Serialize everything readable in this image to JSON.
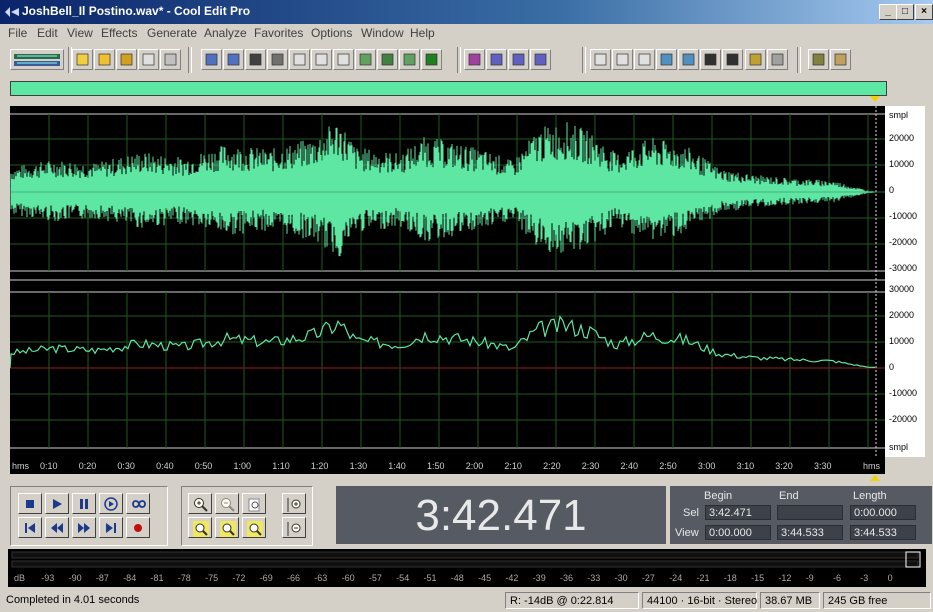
{
  "window": {
    "title": "JoshBell_Il Postino.wav* - Cool Edit Pro",
    "minimize_glyph": "_",
    "maximize_glyph": "□",
    "close_glyph": "×"
  },
  "menu": [
    "File",
    "Edit",
    "View",
    "Effects",
    "Generate",
    "Analyze",
    "Favorites",
    "Options",
    "Window",
    "Help"
  ],
  "toolbar": {
    "icons": [
      "multitrack-toggle-icon",
      "new-file-icon",
      "open-file-icon",
      "save-icon",
      "save-all-icon",
      "close-file-icon",
      "undo-icon",
      "redo-icon",
      "repeat-last-icon",
      "cut-icon",
      "copy-icon",
      "paste-icon",
      "mix-paste-icon",
      "trim-icon",
      "envelope-icon",
      "favorites-icon",
      "spectral-view-icon",
      "waveform-view-icon",
      "spectral-freq-icon",
      "spectral-pan-icon",
      "cue-list-icon",
      "play-list-icon",
      "info-icon",
      "zoom-out-full-icon",
      "zoom-to-sel-icon",
      "time-format-icon",
      "snap-icon",
      "levels-icon",
      "status-icon",
      "settings-icon",
      "script-icon",
      "help-icon"
    ]
  },
  "waveform": {
    "top_channel_labels": [
      "smpl",
      "20000",
      "10000",
      "0",
      "-10000",
      "-20000",
      "-30000"
    ],
    "bottom_channel_labels": [
      "30000",
      "20000",
      "10000",
      "0",
      "-10000",
      "-20000",
      "smpl"
    ],
    "color": "#5ee6a3",
    "grid_color": "#1f5a1f"
  },
  "timeline": {
    "start_label": "hms",
    "end_label": "hms",
    "ticks": [
      "0:10",
      "0:20",
      "0:30",
      "0:40",
      "0:50",
      "1:00",
      "1:10",
      "1:20",
      "1:30",
      "1:40",
      "1:50",
      "2:00",
      "2:10",
      "2:20",
      "2:30",
      "2:40",
      "2:50",
      "3:00",
      "3:10",
      "3:20",
      "3:30"
    ]
  },
  "time_display": "3:42.471",
  "selection": {
    "headers": {
      "begin": "Begin",
      "end": "End",
      "length": "Length"
    },
    "sel": {
      "label": "Sel",
      "begin": "3:42.471",
      "end": "",
      "length": "0:00.000"
    },
    "view": {
      "label": "View",
      "begin": "0:00.000",
      "end": "3:44.533",
      "length": "3:44.533"
    }
  },
  "meter": {
    "db_labels": [
      "dB",
      "-93",
      "-90",
      "-87",
      "-84",
      "-81",
      "-78",
      "-75",
      "-72",
      "-69",
      "-66",
      "-63",
      "-60",
      "-57",
      "-54",
      "-51",
      "-48",
      "-45",
      "-42",
      "-39",
      "-36",
      "-33",
      "-30",
      "-27",
      "-24",
      "-21",
      "-18",
      "-15",
      "-12",
      "-9",
      "-6",
      "-3",
      "0"
    ]
  },
  "status": {
    "message": "Completed in 4.01 seconds",
    "cursor": "R: -14dB @   0:22.814",
    "format": "44100 · 16-bit · Stereo",
    "file_size": "38.67 MB",
    "disk_free": "245 GB free"
  }
}
